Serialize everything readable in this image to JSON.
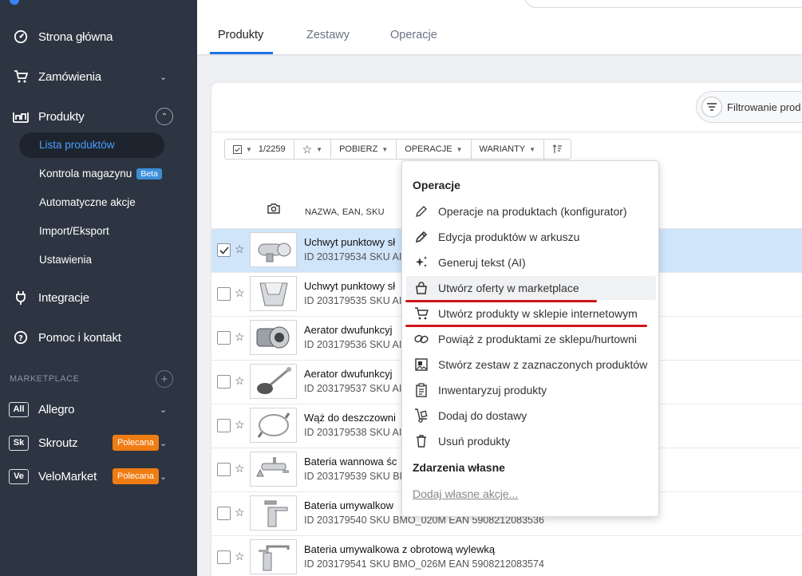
{
  "sidebar": {
    "nav": [
      {
        "label": "Strona główna",
        "icon": "dashboard-icon"
      },
      {
        "label": "Zamówienia",
        "icon": "cart-icon"
      },
      {
        "label": "Produkty",
        "icon": "products-icon"
      },
      {
        "label": "Integracje",
        "icon": "plug-icon"
      },
      {
        "label": "Pomoc i kontakt",
        "icon": "help-icon"
      }
    ],
    "sub": [
      {
        "label": "Lista produktów"
      },
      {
        "label": "Kontrola magazynu",
        "badge": "Beta"
      },
      {
        "label": "Automatyczne akcje"
      },
      {
        "label": "Import/Eksport"
      },
      {
        "label": "Ustawienia"
      }
    ],
    "marketplace_header": "MARKETPLACE",
    "marketplaces": [
      {
        "abbr": "All",
        "label": "Allegro",
        "badge": ""
      },
      {
        "abbr": "Sk",
        "label": "Skroutz",
        "badge": "Polecana"
      },
      {
        "abbr": "Ve",
        "label": "VeloMarket",
        "badge": "Polecana"
      }
    ],
    "accent_color": "#4a9eff"
  },
  "tabs": [
    {
      "label": "Produkty",
      "active": true
    },
    {
      "label": "Zestawy",
      "active": false
    },
    {
      "label": "Operacje",
      "active": false
    }
  ],
  "filter": {
    "label": "Filtrowanie prod"
  },
  "toolbar": {
    "selection": "1/2259",
    "download": "POBIERZ",
    "operations": "OPERACJE",
    "variants": "WARIANTY"
  },
  "table": {
    "column_name": "NAZWA, EAN, SKU",
    "rows": [
      {
        "name": "Uchwyt punktowy sł",
        "id": "ID 203179534 SKU AI",
        "selected": true
      },
      {
        "name": "Uchwyt punktowy sł",
        "id": "ID 203179535 SKU AI",
        "selected": false
      },
      {
        "name": "Aerator dwufunkcyj",
        "id": "ID 203179536 SKU AI",
        "selected": false
      },
      {
        "name": "Aerator dwufunkcyj",
        "id": "ID 203179537 SKU AI",
        "selected": false
      },
      {
        "name": "Wąż do deszczowni",
        "id": "ID 203179538 SKU AI",
        "selected": false
      },
      {
        "name": "Bateria wannowa śc",
        "id": "ID 203179539 SKU BI",
        "selected": false
      },
      {
        "name": "Bateria umywalkow",
        "id": "ID 203179540 SKU BMO_020M EAN 5908212083536",
        "selected": false
      },
      {
        "name": "Bateria umywalkowa z obrotową wylewką",
        "id": "ID 203179541 SKU BMO_026M EAN 5908212083574",
        "selected": false
      }
    ]
  },
  "dropdown": {
    "header_operations": "Operacje",
    "items": [
      {
        "label": "Operacje na produktach (konfigurator)",
        "icon": "pencil-icon"
      },
      {
        "label": "Edycja produktów w arkuszu",
        "icon": "pen-icon"
      },
      {
        "label": "Generuj tekst (AI)",
        "icon": "sparkle-icon"
      },
      {
        "label": "Utwórz oferty w marketplace",
        "icon": "shopping-bag-icon"
      },
      {
        "label": "Utwórz produkty w sklepie internetowym",
        "icon": "cart-icon"
      },
      {
        "label": "Powiąż z produktami ze sklepu/hurtowni",
        "icon": "link-icon"
      },
      {
        "label": "Stwórz zestaw z zaznaczonych produktów",
        "icon": "bundle-icon"
      },
      {
        "label": "Inwentaryzuj produkty",
        "icon": "clipboard-icon"
      },
      {
        "label": "Dodaj do dostawy",
        "icon": "dolly-icon"
      },
      {
        "label": "Usuń produkty",
        "icon": "trash-icon"
      }
    ],
    "header_custom": "Zdarzenia własne",
    "custom_link": "Dodaj własne akcje..."
  },
  "colors": {
    "highlight_underline": "#d0151b",
    "selected_row": "#d0e5fa",
    "badge_orange": "#f07d14"
  }
}
